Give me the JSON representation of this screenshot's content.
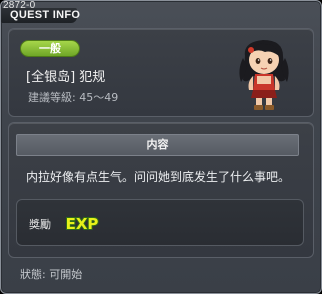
{
  "window": {
    "quest_id": "2872-0",
    "title": "QUEST INFO"
  },
  "quest": {
    "category_badge": "一般",
    "name": "[全银岛] 犯规",
    "recommended_level": "建議等級: 45～49",
    "npc_icon": "npc-girl-portrait-icon"
  },
  "content": {
    "header": "内容",
    "description": "内拉好像有点生气。问问她到底发生了什么事吧。"
  },
  "reward": {
    "label": "獎勵",
    "exp_icon_text": "EXP"
  },
  "status": {
    "text": "狀態: 可開始"
  },
  "colors": {
    "badge_green": "#8cc63f",
    "exp_yellow": "#e8f11a",
    "panel_bg": "#3a3f47"
  }
}
